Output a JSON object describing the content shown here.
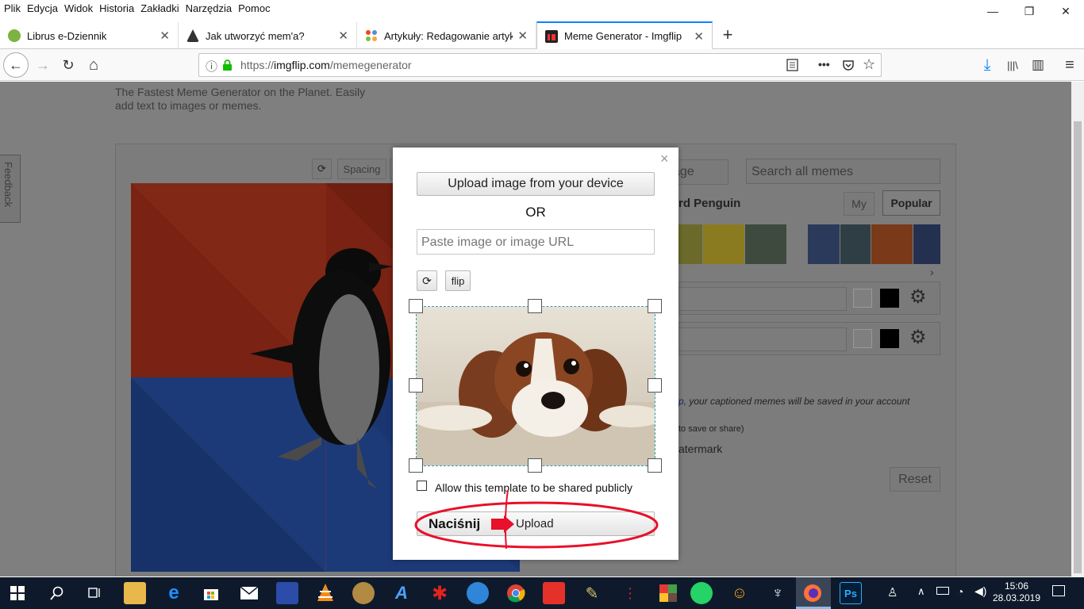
{
  "menubar": {
    "items": [
      "Plik",
      "Edycja",
      "Widok",
      "Historia",
      "Zakładki",
      "Narzędzia",
      "Pomoc"
    ],
    "minimize": "—",
    "restore": "❐",
    "close": "✕"
  },
  "tabs": [
    {
      "title": "Librus e-Dziennik",
      "close": "✕"
    },
    {
      "title": "Jak utworzyć mem'a?",
      "close": "✕"
    },
    {
      "title": "Artykuły: Redagowanie artykułu",
      "close": "✕"
    },
    {
      "title": "Meme Generator - Imgflip",
      "close": "✕"
    }
  ],
  "new_tab": "+",
  "nav": {
    "back": "←",
    "forward": "→",
    "reload": "↻",
    "home": "⌂",
    "info": "ⓘ",
    "url_prefix": "https://",
    "url_host": "imgflip.com",
    "url_path": "/memegenerator",
    "more": "•••",
    "download": "⤓",
    "library": "|||\\",
    "sidebar": "▥",
    "menu": "≡"
  },
  "page": {
    "tagline_1": "The Fastest Meme Generator on the Planet. Easily",
    "tagline_2": "add text to images or memes.",
    "feedback": "Feedback",
    "spacing_btn": "Spacing",
    "rotate_btn": "⟳",
    "upload_partial": "age",
    "search_placeholder": "Search all memes",
    "meme_name_partial": "rd Penguin",
    "tab_my": "My",
    "tab_popular": "Popular",
    "scroll_right": "›",
    "gear": "⚙",
    "login_note_link": "p",
    "login_note": ", your captioned memes will be saved in your account",
    "save_note": "to save or share)",
    "watermark_partial": "atermark",
    "reset_btn": "Reset"
  },
  "modal": {
    "close": "×",
    "upload_device": "Upload image from your device",
    "or": "OR",
    "url_placeholder": "Paste image or image URL",
    "rotate": "⟳",
    "flip": "flip",
    "share_label": "Allow this template to be shared publicly",
    "upload_btn": "Upload",
    "annotation": "Naciśnij"
  },
  "taskbar": {
    "time": "15:06",
    "date": "28.03.2019"
  },
  "colors": {
    "accent": "#0a84ff",
    "annotation": "#e8102a",
    "overlay": "#7f7f7f",
    "taskbar": "#0e1a2b"
  }
}
